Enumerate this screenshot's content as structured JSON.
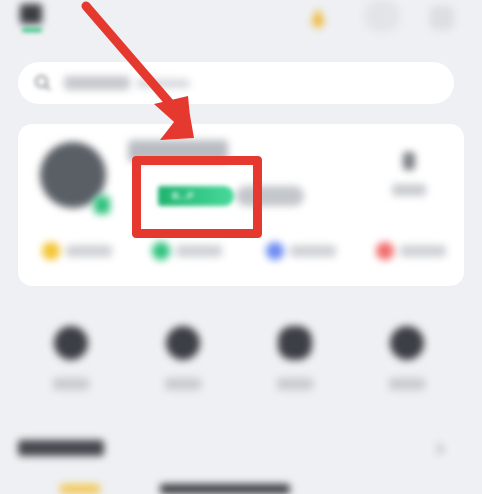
{
  "profile_card": {
    "member_badge": {
      "text": "B…P",
      "color": "#2ec27e"
    }
  },
  "annotation": {
    "highlight_color": "#e5382e",
    "arrow_color": "#e5382e"
  },
  "icons": {
    "bell": "bell-icon",
    "search": "search-icon",
    "chevron": "chevron-right-icon"
  }
}
